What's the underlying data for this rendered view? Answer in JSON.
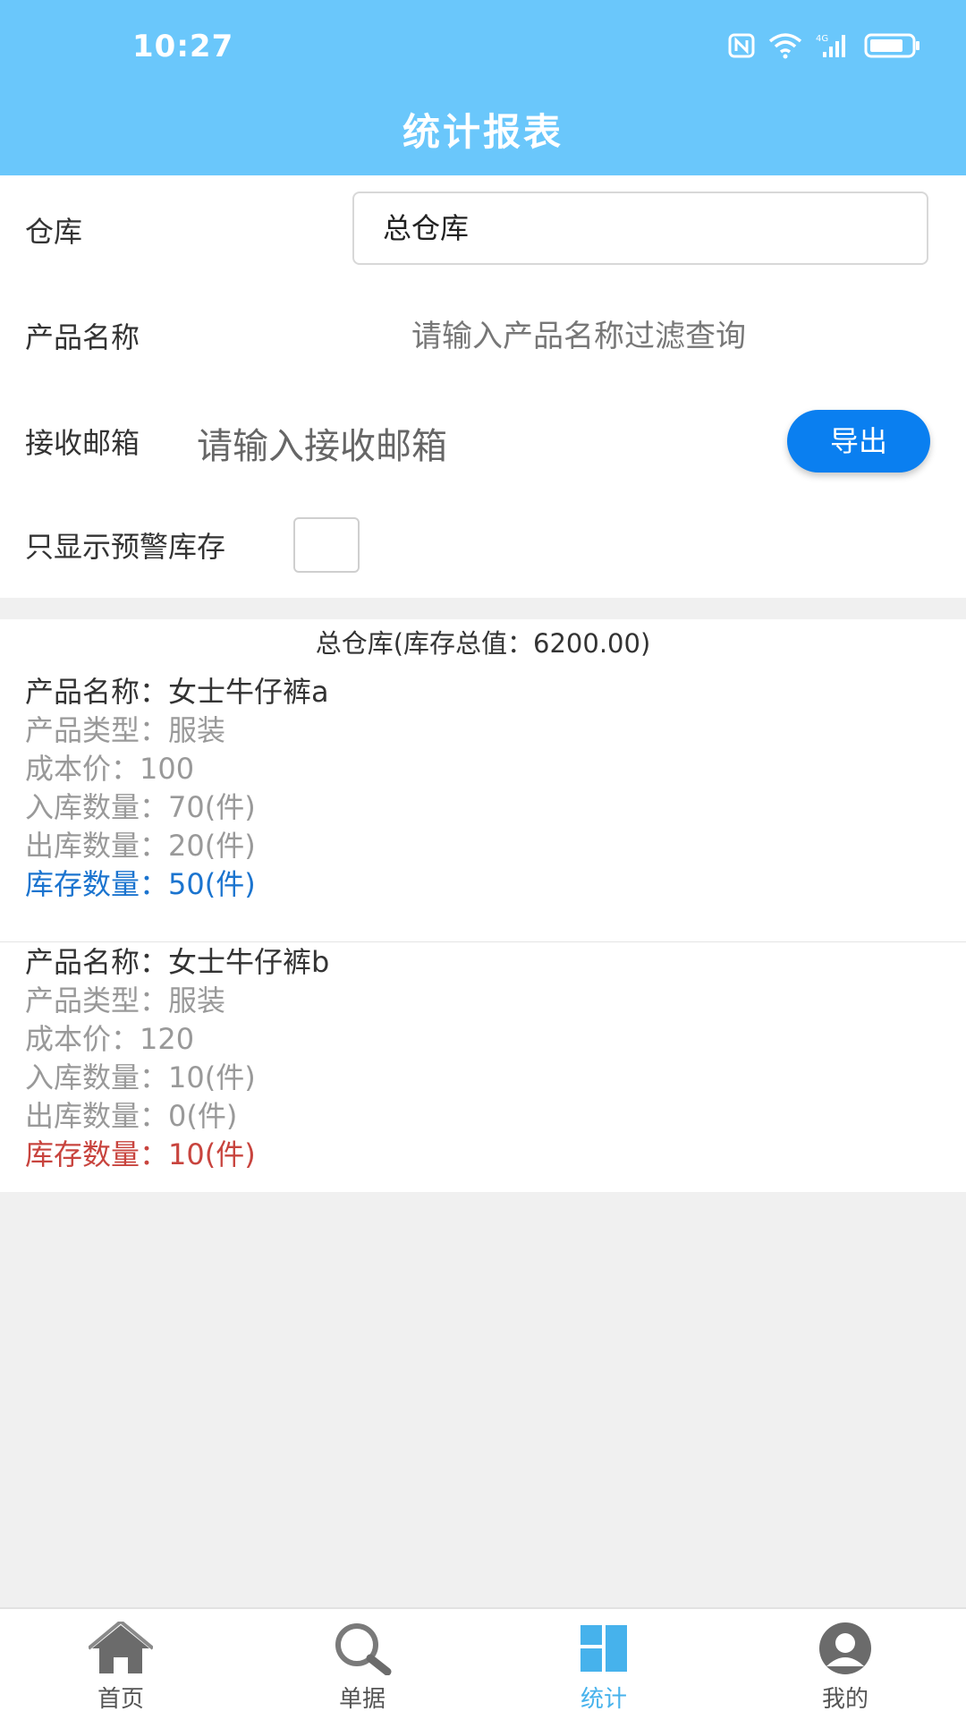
{
  "status_bar": {
    "time": "10:27",
    "network": "4G"
  },
  "header": {
    "title": "统计报表"
  },
  "form": {
    "warehouse_label": "仓库",
    "warehouse_value": "总仓库",
    "product_label": "产品名称",
    "product_placeholder": "请输入产品名称过滤查询",
    "email_label": "接收邮箱",
    "email_placeholder": "请输入接收邮箱",
    "export_label": "导出",
    "warning_label": "只显示预警库存",
    "warning_checked": false
  },
  "summary": "总仓库(库存总值：6200.00)",
  "products": [
    {
      "name": "产品名称：女士牛仔裤a",
      "type": "产品类型：服装",
      "cost": "成本价：100",
      "in_qty": "入库数量：70(件)",
      "out_qty": "出库数量：20(件)",
      "stock": "库存数量：50(件)",
      "stock_color": "#1b74cf"
    },
    {
      "name": "产品名称：女士牛仔裤b",
      "type": "产品类型：服装",
      "cost": "成本价：120",
      "in_qty": "入库数量：10(件)",
      "out_qty": "出库数量：0(件)",
      "stock": "库存数量：10(件)",
      "stock_color": "#c8443e"
    }
  ],
  "nav": {
    "items": [
      {
        "label": "首页",
        "icon": "home-icon"
      },
      {
        "label": "单据",
        "icon": "search-icon"
      },
      {
        "label": "统计",
        "icon": "stats-icon",
        "active": true
      },
      {
        "label": "我的",
        "icon": "user-icon"
      }
    ]
  },
  "colors": {
    "header": "#6ac7fb",
    "accent": "#0a7ff0",
    "nav_active": "#46b2ec"
  }
}
